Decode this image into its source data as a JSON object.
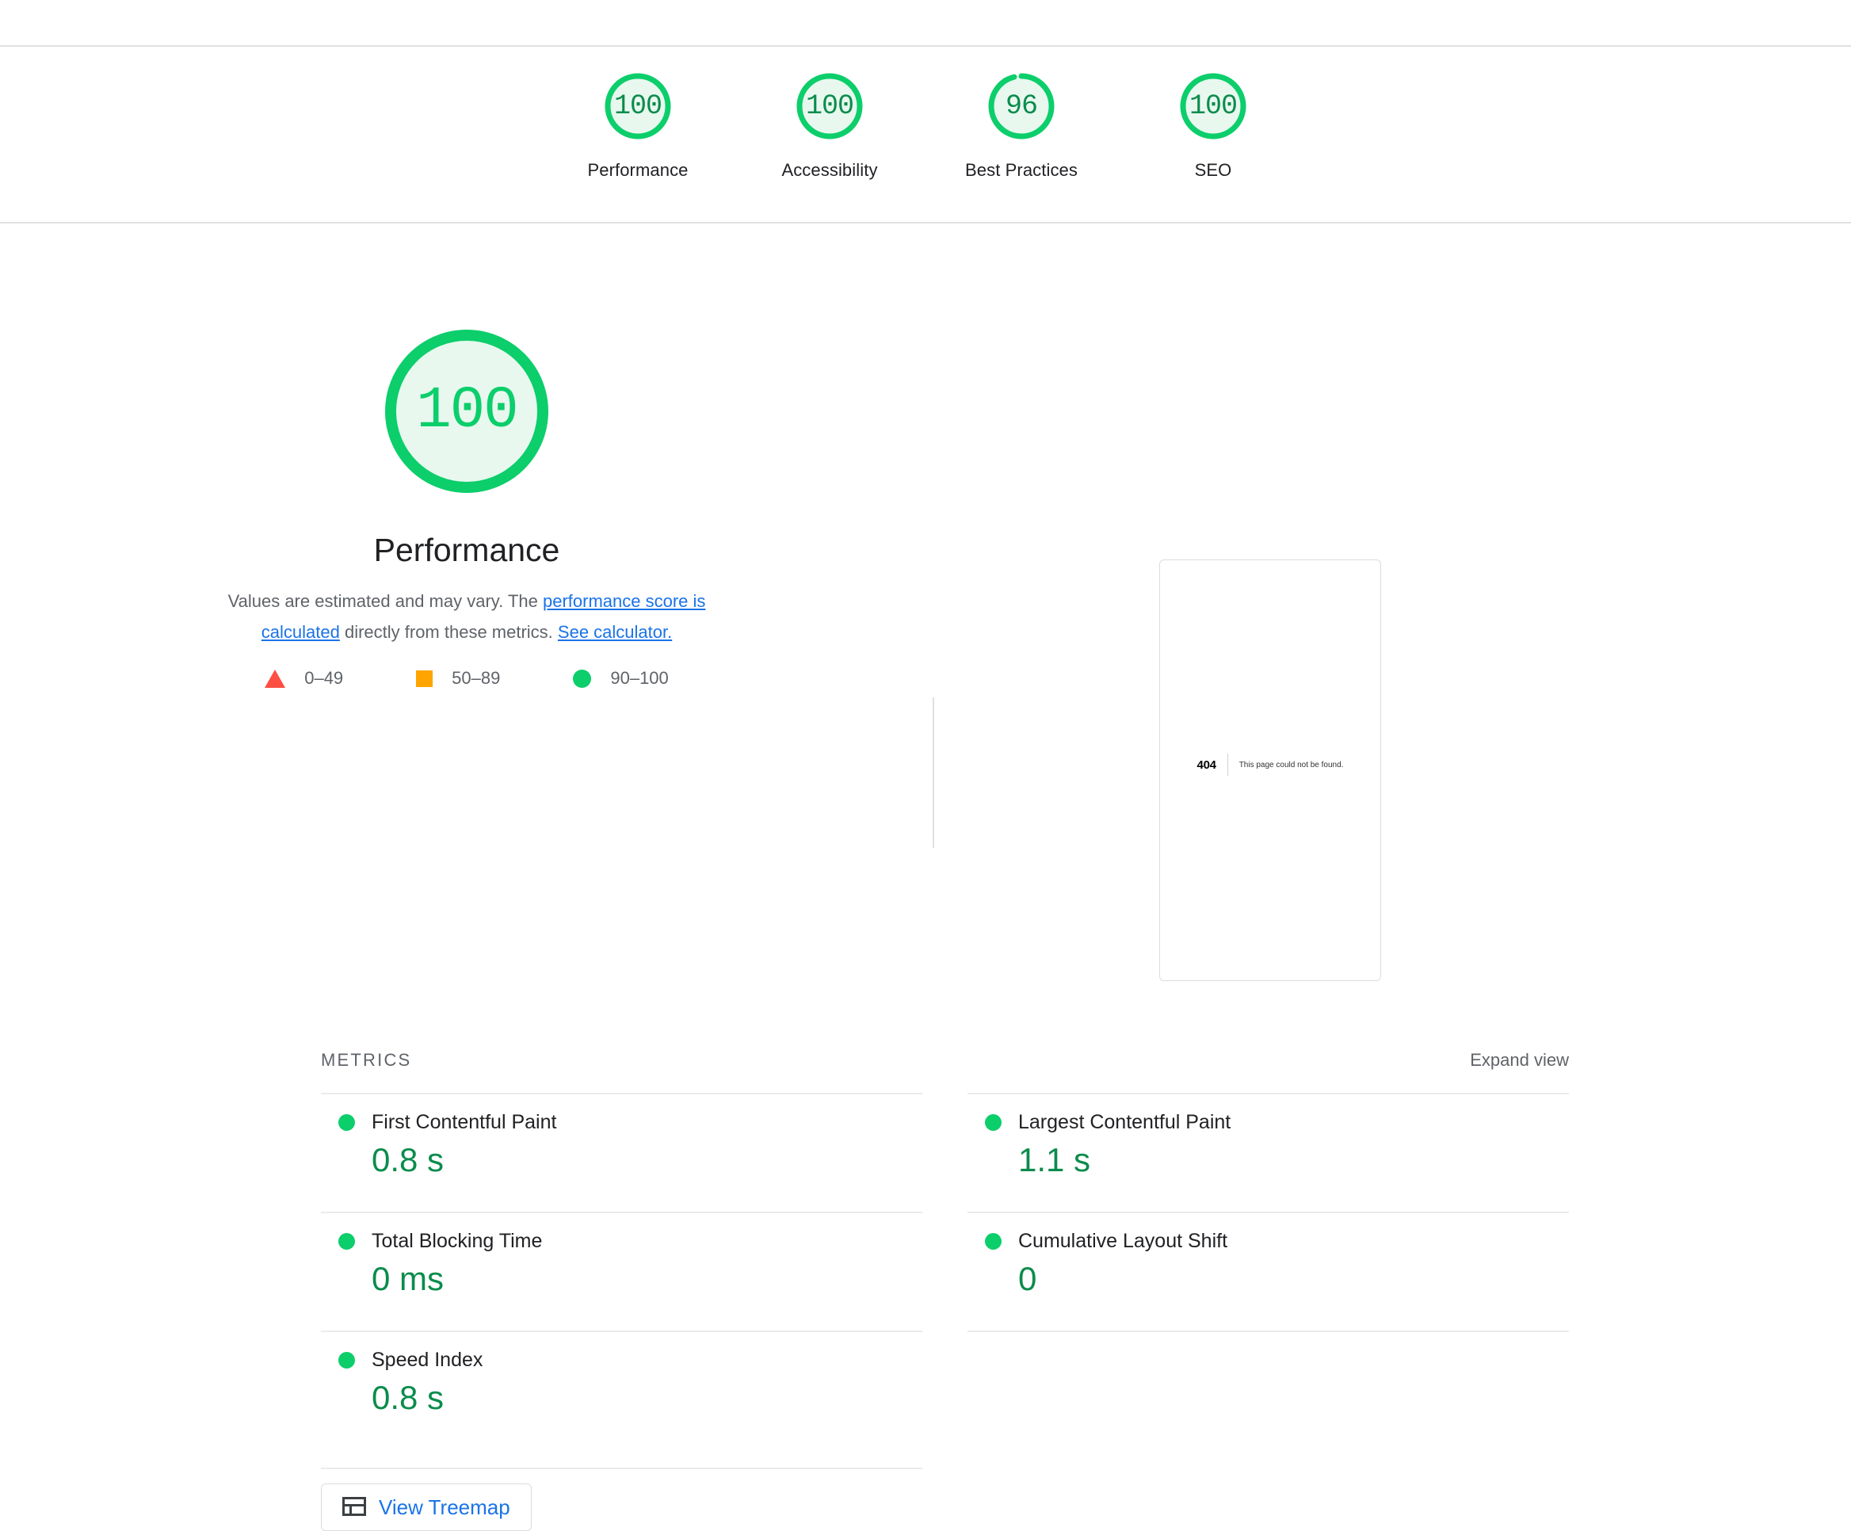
{
  "categories": [
    {
      "label": "Performance",
      "score": "100",
      "score_num": 100
    },
    {
      "label": "Accessibility",
      "score": "100",
      "score_num": 100
    },
    {
      "label": "Best Practices",
      "score": "96",
      "score_num": 96
    },
    {
      "label": "SEO",
      "score": "100",
      "score_num": 100
    }
  ],
  "performance": {
    "score": "100",
    "score_num": 100,
    "title": "Performance",
    "desc_part1": "Values are estimated and may vary. The ",
    "desc_link1": "performance score is calculated",
    "desc_part2": " directly from these metrics. ",
    "desc_link2": "See calculator."
  },
  "legend": [
    {
      "icon": "triangle-fail-icon",
      "range": "0–49",
      "color": "#ff4e42"
    },
    {
      "icon": "square-average-icon",
      "range": "50–89",
      "color": "#ffa400"
    },
    {
      "icon": "circle-pass-icon",
      "range": "90–100",
      "color": "#0cce6b"
    }
  ],
  "thumbnail": {
    "code": "404",
    "message": "This page could not be found."
  },
  "metrics_section": {
    "title": "METRICS",
    "expand_label": "Expand view"
  },
  "metrics": {
    "left": [
      {
        "name": "First Contentful Paint",
        "value": "0.8 s",
        "status": "pass"
      },
      {
        "name": "Total Blocking Time",
        "value": "0 ms",
        "status": "pass"
      },
      {
        "name": "Speed Index",
        "value": "0.8 s",
        "status": "pass"
      }
    ],
    "right": [
      {
        "name": "Largest Contentful Paint",
        "value": "1.1 s",
        "status": "pass"
      },
      {
        "name": "Cumulative Layout Shift",
        "value": "0",
        "status": "pass"
      }
    ]
  },
  "treemap": {
    "label": "View Treemap",
    "icon": "treemap-icon"
  },
  "colors": {
    "pass": "#0cce6b",
    "average": "#ffa400",
    "fail": "#ff4e42",
    "pass_text": "#0b8c4c",
    "link": "#1a73e8"
  }
}
